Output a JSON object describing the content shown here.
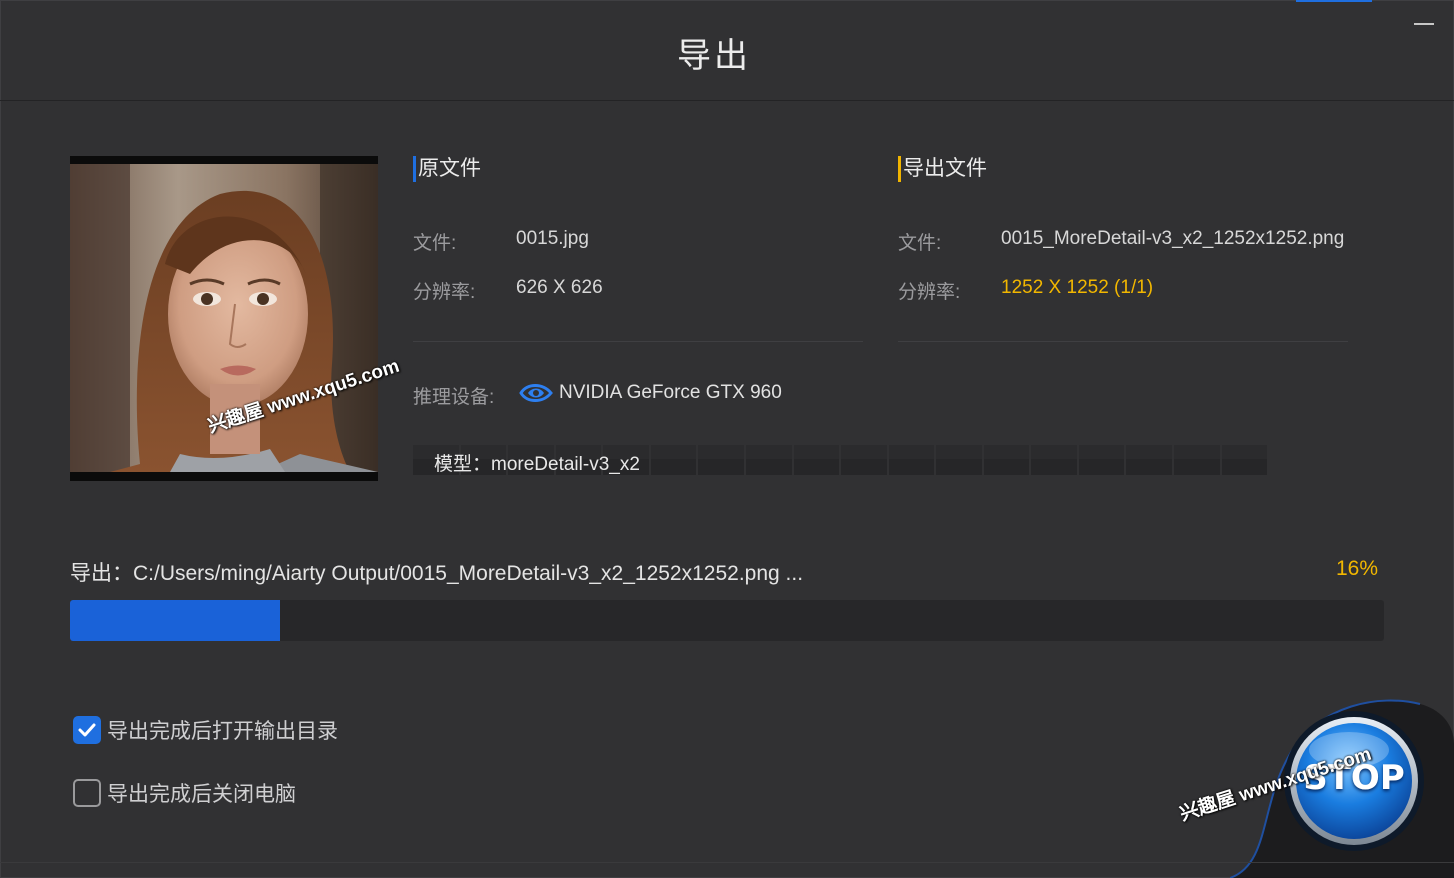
{
  "dialog": {
    "title": "导出"
  },
  "source": {
    "header": "原文件",
    "file_label": "文件:",
    "file_value": "0015.jpg",
    "resolution_label": "分辨率:",
    "resolution_value": "626 X 626"
  },
  "output": {
    "header": "导出文件",
    "file_label": "文件:",
    "file_value": "0015_MoreDetail-v3_x2_1252x1252.png",
    "resolution_label": "分辨率:",
    "resolution_value": "1252 X 1252 (1/1)"
  },
  "device": {
    "label": "推理设备:",
    "icon": "nvidia-icon",
    "value": "NVIDIA GeForce GTX 960"
  },
  "model": {
    "text": "模型：moreDetail-v3_x2"
  },
  "export": {
    "path_text": "导出：C:/Users/ming/Aiarty Output/0015_MoreDetail-v3_x2_1252x1252.png ...",
    "percent_text": "16%",
    "progress": 0.16
  },
  "options": [
    {
      "label": "导出完成后打开输出目录",
      "checked": true
    },
    {
      "label": "导出完成后关闭电脑",
      "checked": false
    }
  ],
  "stop_button": {
    "label": "STOP"
  },
  "watermark": {
    "text": "兴趣屋 www.xqu5.com"
  },
  "colors": {
    "background": "#313133",
    "accent_blue": "#1f6fe0",
    "accent_yellow": "#f2b700",
    "progress_fill": "#1a62d8"
  }
}
